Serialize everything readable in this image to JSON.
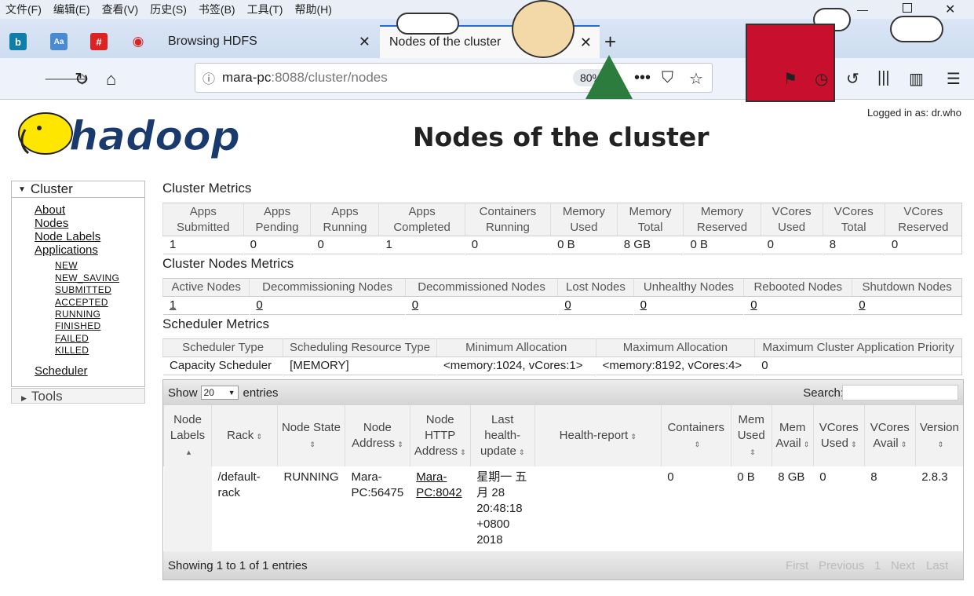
{
  "menu": [
    "文件(F)",
    "编辑(E)",
    "查看(V)",
    "历史(S)",
    "书签(B)",
    "工具(T)",
    "帮助(H)"
  ],
  "tabs": [
    {
      "label": "Browsing HDFS",
      "close": "✕"
    },
    {
      "label": "Nodes of the cluster",
      "close": "✕"
    }
  ],
  "new_tab": "+",
  "url": {
    "host": "mara-pc",
    "rest": ":8088/cluster/nodes"
  },
  "zoom": "80%",
  "page": {
    "logged_in": "Logged in as: dr.who",
    "title": "Nodes of the cluster",
    "logo_text": "hadoop"
  },
  "sidebar": {
    "cluster": "Cluster",
    "links": [
      "About",
      "Nodes",
      "Node Labels",
      "Applications"
    ],
    "apps": [
      "NEW",
      "NEW_SAVING",
      "SUBMITTED",
      "ACCEPTED",
      "RUNNING",
      "FINISHED",
      "FAILED",
      "KILLED"
    ],
    "scheduler": "Scheduler",
    "tools": "Tools"
  },
  "cluster_metrics": {
    "title": "Cluster Metrics",
    "headers": [
      [
        "Apps",
        "Submitted"
      ],
      [
        "Apps",
        "Pending"
      ],
      [
        "Apps",
        "Running"
      ],
      [
        "Apps",
        "Completed"
      ],
      [
        "Containers",
        "Running"
      ],
      [
        "Memory",
        "Used"
      ],
      [
        "Memory",
        "Total"
      ],
      [
        "Memory",
        "Reserved"
      ],
      [
        "VCores",
        "Used"
      ],
      [
        "VCores",
        "Total"
      ],
      [
        "VCores",
        "Reserved"
      ]
    ],
    "values": [
      "1",
      "0",
      "0",
      "1",
      "0",
      "0 B",
      "8 GB",
      "0 B",
      "0",
      "8",
      "0"
    ]
  },
  "node_metrics": {
    "title": "Cluster Nodes Metrics",
    "headers": [
      "Active Nodes",
      "Decommissioning Nodes",
      "Decommissioned Nodes",
      "Lost Nodes",
      "Unhealthy Nodes",
      "Rebooted Nodes",
      "Shutdown Nodes"
    ],
    "values": [
      "1",
      "0",
      "0",
      "0",
      "0",
      "0",
      "0"
    ]
  },
  "scheduler_metrics": {
    "title": "Scheduler Metrics",
    "headers": [
      "Scheduler Type",
      "Scheduling Resource Type",
      "Minimum Allocation",
      "Maximum Allocation",
      "Maximum Cluster Application Priority"
    ],
    "values": [
      "Capacity Scheduler",
      "[MEMORY]",
      "<memory:1024, vCores:1>",
      "<memory:8192, vCores:4>",
      "0"
    ]
  },
  "nodes": {
    "show_label": "Show",
    "show_value": "20",
    "entries_label": "entries",
    "search_label": "Search:",
    "headers": [
      "Node Labels",
      "Rack",
      "Node State",
      "Node Address",
      "Node HTTP Address",
      "Last health-update",
      "Health-report",
      "Containers",
      "Mem Used",
      "Mem Avail",
      "VCores Used",
      "VCores Avail",
      "Version"
    ],
    "row": {
      "labels": "",
      "rack": "/default-rack",
      "state": "RUNNING",
      "address": "Mara-PC:56475",
      "http": "Mara-PC:8042",
      "last_health": "星期一 五月 28 20:48:18 +0800 2018",
      "report": "",
      "containers": "0",
      "mem_used": "0 B",
      "mem_avail": "8 GB",
      "vcores_used": "0",
      "vcores_avail": "8",
      "version": "2.8.3"
    },
    "info": "Showing 1 to 1 of 1 entries",
    "pager": [
      "First",
      "Previous",
      "1",
      "Next",
      "Last"
    ]
  }
}
